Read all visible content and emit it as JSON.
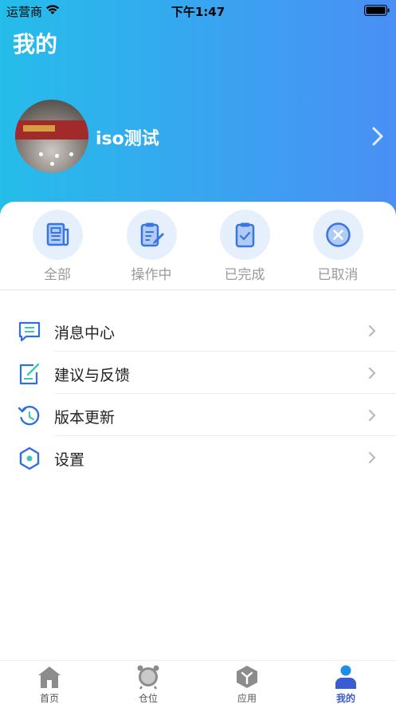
{
  "status_bar": {
    "carrier": "运营商",
    "time": "下午1:47"
  },
  "header": {
    "title": "我的",
    "user_name": "iso测试"
  },
  "orders": [
    {
      "label": "全部",
      "icon": "document-icon"
    },
    {
      "label": "操作中",
      "icon": "clipboard-edit-icon"
    },
    {
      "label": "已完成",
      "icon": "clipboard-check-icon"
    },
    {
      "label": "已取消",
      "icon": "cancel-circle-icon"
    }
  ],
  "menu": [
    {
      "label": "消息中心",
      "icon": "message-icon"
    },
    {
      "label": "建议与反馈",
      "icon": "feedback-edit-icon"
    },
    {
      "label": "版本更新",
      "icon": "history-icon"
    },
    {
      "label": "设置",
      "icon": "settings-hexagon-icon"
    }
  ],
  "tabs": [
    {
      "label": "首页",
      "icon": "home-icon",
      "active": false
    },
    {
      "label": "仓位",
      "icon": "alarm-clock-icon",
      "active": false
    },
    {
      "label": "应用",
      "icon": "apps-cube-icon",
      "active": false
    },
    {
      "label": "我的",
      "icon": "user-icon",
      "active": true
    }
  ],
  "colors": {
    "header_gradient_start": "#25bdea",
    "header_gradient_end": "#4a8ff5",
    "accent": "#3a7bea",
    "active_tab": "#3a5bd1"
  }
}
